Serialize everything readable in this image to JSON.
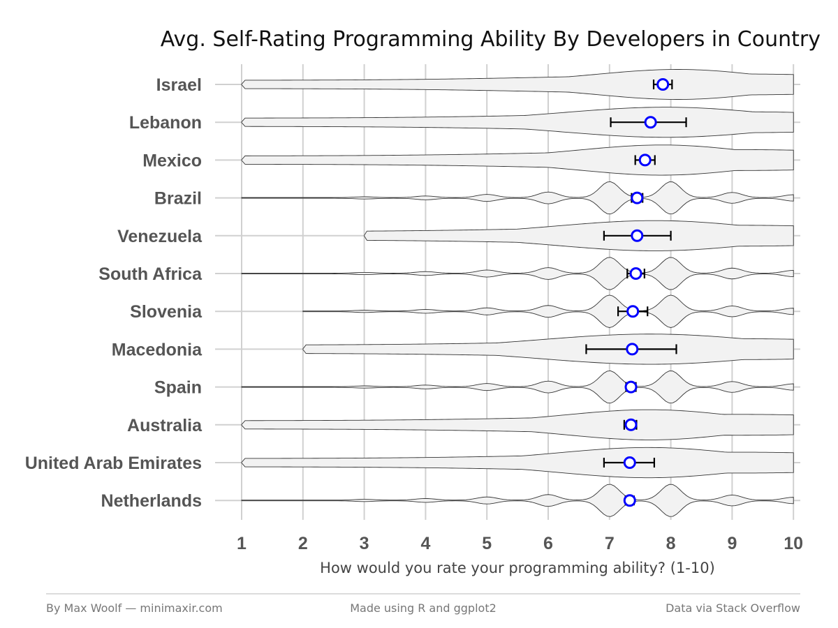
{
  "chart_data": {
    "type": "violin",
    "title": "Avg. Self-Rating Programming Ability By Developers in Country",
    "xlabel": "How would you rate your programming ability? (1-10)",
    "ylabel": "",
    "xlim": [
      1,
      10
    ],
    "x_ticks": [
      "1",
      "2",
      "3",
      "4",
      "5",
      "6",
      "7",
      "8",
      "9",
      "10"
    ],
    "grid": true,
    "colors": {
      "violin_fill": "#f2f2f2",
      "violin_stroke": "#333333",
      "mean_point": "#0000ff",
      "error_bar": "#000000",
      "grid": "#d0d0d0"
    },
    "series": [
      {
        "name": "Israel",
        "mean": 7.87,
        "ci_low": 7.72,
        "ci_high": 8.02,
        "min": 1
      },
      {
        "name": "Lebanon",
        "mean": 7.67,
        "ci_low": 7.02,
        "ci_high": 8.25,
        "min": 1
      },
      {
        "name": "Mexico",
        "mean": 7.58,
        "ci_low": 7.42,
        "ci_high": 7.74,
        "min": 1
      },
      {
        "name": "Brazil",
        "mean": 7.45,
        "ci_low": 7.36,
        "ci_high": 7.54,
        "min": 1
      },
      {
        "name": "Venezuela",
        "mean": 7.45,
        "ci_low": 6.91,
        "ci_high": 8.0,
        "min": 3
      },
      {
        "name": "South Africa",
        "mean": 7.43,
        "ci_low": 7.29,
        "ci_high": 7.57,
        "min": 1
      },
      {
        "name": "Slovenia",
        "mean": 7.38,
        "ci_low": 7.14,
        "ci_high": 7.62,
        "min": 2
      },
      {
        "name": "Macedonia",
        "mean": 7.37,
        "ci_low": 6.62,
        "ci_high": 8.09,
        "min": 2
      },
      {
        "name": "Spain",
        "mean": 7.35,
        "ci_low": 7.27,
        "ci_high": 7.43,
        "min": 1
      },
      {
        "name": "Australia",
        "mean": 7.35,
        "ci_low": 7.24,
        "ci_high": 7.44,
        "min": 1
      },
      {
        "name": "United Arab Emirates",
        "mean": 7.33,
        "ci_low": 6.91,
        "ci_high": 7.73,
        "min": 1
      },
      {
        "name": "Netherlands",
        "mean": 7.33,
        "ci_low": 7.26,
        "ci_high": 7.4,
        "min": 1
      }
    ]
  },
  "footer": {
    "left": "By Max Woolf — minimaxir.com",
    "center": "Made using R and ggplot2",
    "right": "Data via Stack Overflow"
  }
}
